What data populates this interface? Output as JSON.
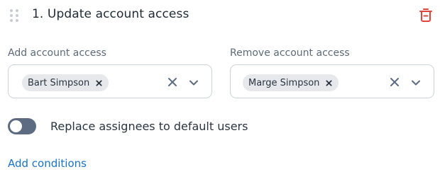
{
  "header": {
    "title": "1. Update account access",
    "drag_icon": "drag-handle-icon",
    "delete_icon": "trash-icon"
  },
  "add_access": {
    "label": "Add account access",
    "selected": [
      "Bart Simpson"
    ],
    "clear_icon": "close-icon",
    "dropdown_icon": "chevron-down-icon"
  },
  "remove_access": {
    "label": "Remove account access",
    "selected": [
      "Marge Simpson"
    ],
    "clear_icon": "close-icon",
    "dropdown_icon": "chevron-down-icon"
  },
  "toggle": {
    "label": "Replace assignees to default users",
    "state": "off"
  },
  "actions": {
    "add_conditions": "Add conditions"
  },
  "colors": {
    "danger": "#e0453a",
    "link": "#1a73c9",
    "toggle_off": "#5d6b82",
    "chip_bg": "#e6e8eb",
    "border": "#cdd4dc"
  }
}
